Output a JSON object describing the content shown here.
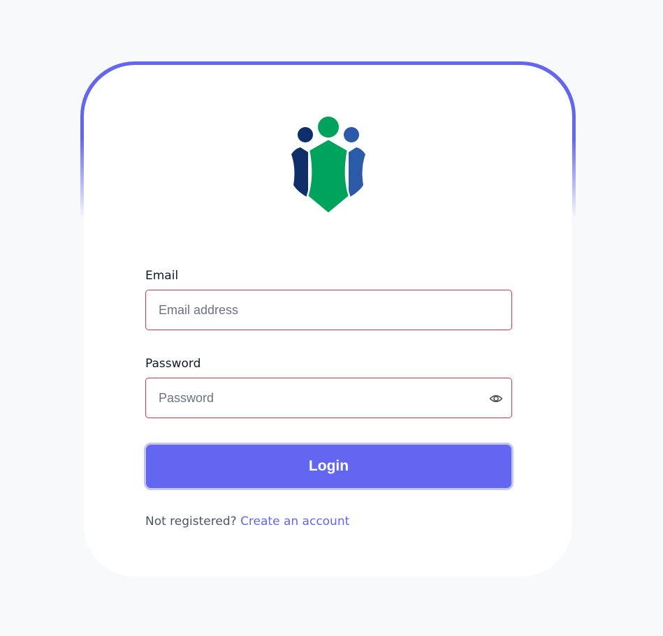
{
  "login_form": {
    "email_label": "Email",
    "email_placeholder": "Email address",
    "email_value": "",
    "password_label": "Password",
    "password_placeholder": "Password",
    "password_value": "",
    "login_label": "Login",
    "register_prompt": "Not registered?",
    "register_link": "Create an account"
  },
  "icons": {
    "logo": "people-group-logo",
    "password_toggle": "eye-icon"
  },
  "colors": {
    "accent": "#6366f1",
    "input_error_border": "#dc3545",
    "logo_green": "#00a35c",
    "logo_navy": "#0f2f6b",
    "logo_blue": "#2a5aa8",
    "background": "#f8f9fb"
  }
}
